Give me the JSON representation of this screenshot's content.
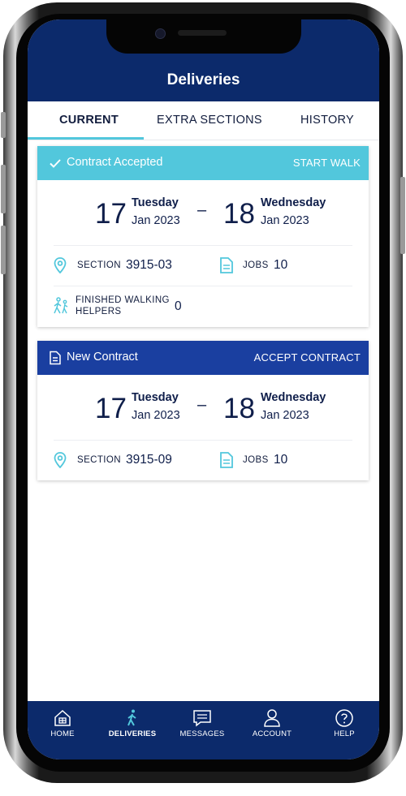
{
  "header": {
    "title": "Deliveries"
  },
  "tabs": [
    {
      "label": "CURRENT",
      "active": true
    },
    {
      "label": "EXTRA SECTIONS",
      "active": false
    },
    {
      "label": "HISTORY",
      "active": false
    }
  ],
  "cards": [
    {
      "status_label": "Contract Accepted",
      "status_icon": "check-icon",
      "action_label": "START WALK",
      "header_color": "#52c7dc",
      "start_day": "17",
      "start_weekday": "Tuesday",
      "start_month": "Jan 2023",
      "dash": "–",
      "end_day": "18",
      "end_weekday": "Wednesday",
      "end_month": "Jan 2023",
      "section_label": "SECTION",
      "section_value": "3915-03",
      "jobs_label": "JOBS",
      "jobs_value": "10",
      "helpers_label_line1": "FINISHED WALKING",
      "helpers_label_line2": "HELPERS",
      "helpers_value": "0"
    },
    {
      "status_label": "New Contract",
      "status_icon": "document-icon",
      "action_label": "ACCEPT CONTRACT",
      "header_color": "#1a3fa0",
      "start_day": "17",
      "start_weekday": "Tuesday",
      "start_month": "Jan 2023",
      "dash": "–",
      "end_day": "18",
      "end_weekday": "Wednesday",
      "end_month": "Jan 2023",
      "section_label": "SECTION",
      "section_value": "3915-09",
      "jobs_label": "JOBS",
      "jobs_value": "10"
    }
  ],
  "bottom_nav": [
    {
      "label": "HOME",
      "icon": "home-icon",
      "active": false
    },
    {
      "label": "DELIVERIES",
      "icon": "walking-icon",
      "active": true
    },
    {
      "label": "MESSAGES",
      "icon": "message-icon",
      "active": false
    },
    {
      "label": "ACCOUNT",
      "icon": "person-icon",
      "active": false
    },
    {
      "label": "HELP",
      "icon": "help-icon",
      "active": false
    }
  ],
  "colors": {
    "brand_navy": "#0c2a6b",
    "accent_cyan": "#52c7dc",
    "accept_blue": "#1a3fa0",
    "text_dark": "#0f1e4a"
  }
}
